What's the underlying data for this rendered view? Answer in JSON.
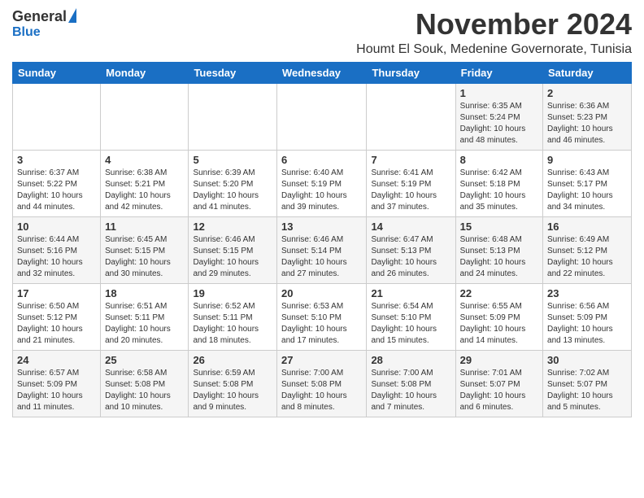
{
  "header": {
    "logo": {
      "general": "General",
      "blue": "Blue"
    },
    "title": "November 2024",
    "subtitle": "Houmt El Souk, Medenine Governorate, Tunisia"
  },
  "weekdays": [
    "Sunday",
    "Monday",
    "Tuesday",
    "Wednesday",
    "Thursday",
    "Friday",
    "Saturday"
  ],
  "weeks": [
    [
      {
        "day": "",
        "info": ""
      },
      {
        "day": "",
        "info": ""
      },
      {
        "day": "",
        "info": ""
      },
      {
        "day": "",
        "info": ""
      },
      {
        "day": "",
        "info": ""
      },
      {
        "day": "1",
        "info": "Sunrise: 6:35 AM\nSunset: 5:24 PM\nDaylight: 10 hours\nand 48 minutes."
      },
      {
        "day": "2",
        "info": "Sunrise: 6:36 AM\nSunset: 5:23 PM\nDaylight: 10 hours\nand 46 minutes."
      }
    ],
    [
      {
        "day": "3",
        "info": "Sunrise: 6:37 AM\nSunset: 5:22 PM\nDaylight: 10 hours\nand 44 minutes."
      },
      {
        "day": "4",
        "info": "Sunrise: 6:38 AM\nSunset: 5:21 PM\nDaylight: 10 hours\nand 42 minutes."
      },
      {
        "day": "5",
        "info": "Sunrise: 6:39 AM\nSunset: 5:20 PM\nDaylight: 10 hours\nand 41 minutes."
      },
      {
        "day": "6",
        "info": "Sunrise: 6:40 AM\nSunset: 5:19 PM\nDaylight: 10 hours\nand 39 minutes."
      },
      {
        "day": "7",
        "info": "Sunrise: 6:41 AM\nSunset: 5:19 PM\nDaylight: 10 hours\nand 37 minutes."
      },
      {
        "day": "8",
        "info": "Sunrise: 6:42 AM\nSunset: 5:18 PM\nDaylight: 10 hours\nand 35 minutes."
      },
      {
        "day": "9",
        "info": "Sunrise: 6:43 AM\nSunset: 5:17 PM\nDaylight: 10 hours\nand 34 minutes."
      }
    ],
    [
      {
        "day": "10",
        "info": "Sunrise: 6:44 AM\nSunset: 5:16 PM\nDaylight: 10 hours\nand 32 minutes."
      },
      {
        "day": "11",
        "info": "Sunrise: 6:45 AM\nSunset: 5:15 PM\nDaylight: 10 hours\nand 30 minutes."
      },
      {
        "day": "12",
        "info": "Sunrise: 6:46 AM\nSunset: 5:15 PM\nDaylight: 10 hours\nand 29 minutes."
      },
      {
        "day": "13",
        "info": "Sunrise: 6:46 AM\nSunset: 5:14 PM\nDaylight: 10 hours\nand 27 minutes."
      },
      {
        "day": "14",
        "info": "Sunrise: 6:47 AM\nSunset: 5:13 PM\nDaylight: 10 hours\nand 26 minutes."
      },
      {
        "day": "15",
        "info": "Sunrise: 6:48 AM\nSunset: 5:13 PM\nDaylight: 10 hours\nand 24 minutes."
      },
      {
        "day": "16",
        "info": "Sunrise: 6:49 AM\nSunset: 5:12 PM\nDaylight: 10 hours\nand 22 minutes."
      }
    ],
    [
      {
        "day": "17",
        "info": "Sunrise: 6:50 AM\nSunset: 5:12 PM\nDaylight: 10 hours\nand 21 minutes."
      },
      {
        "day": "18",
        "info": "Sunrise: 6:51 AM\nSunset: 5:11 PM\nDaylight: 10 hours\nand 20 minutes."
      },
      {
        "day": "19",
        "info": "Sunrise: 6:52 AM\nSunset: 5:11 PM\nDaylight: 10 hours\nand 18 minutes."
      },
      {
        "day": "20",
        "info": "Sunrise: 6:53 AM\nSunset: 5:10 PM\nDaylight: 10 hours\nand 17 minutes."
      },
      {
        "day": "21",
        "info": "Sunrise: 6:54 AM\nSunset: 5:10 PM\nDaylight: 10 hours\nand 15 minutes."
      },
      {
        "day": "22",
        "info": "Sunrise: 6:55 AM\nSunset: 5:09 PM\nDaylight: 10 hours\nand 14 minutes."
      },
      {
        "day": "23",
        "info": "Sunrise: 6:56 AM\nSunset: 5:09 PM\nDaylight: 10 hours\nand 13 minutes."
      }
    ],
    [
      {
        "day": "24",
        "info": "Sunrise: 6:57 AM\nSunset: 5:09 PM\nDaylight: 10 hours\nand 11 minutes."
      },
      {
        "day": "25",
        "info": "Sunrise: 6:58 AM\nSunset: 5:08 PM\nDaylight: 10 hours\nand 10 minutes."
      },
      {
        "day": "26",
        "info": "Sunrise: 6:59 AM\nSunset: 5:08 PM\nDaylight: 10 hours\nand 9 minutes."
      },
      {
        "day": "27",
        "info": "Sunrise: 7:00 AM\nSunset: 5:08 PM\nDaylight: 10 hours\nand 8 minutes."
      },
      {
        "day": "28",
        "info": "Sunrise: 7:00 AM\nSunset: 5:08 PM\nDaylight: 10 hours\nand 7 minutes."
      },
      {
        "day": "29",
        "info": "Sunrise: 7:01 AM\nSunset: 5:07 PM\nDaylight: 10 hours\nand 6 minutes."
      },
      {
        "day": "30",
        "info": "Sunrise: 7:02 AM\nSunset: 5:07 PM\nDaylight: 10 hours\nand 5 minutes."
      }
    ]
  ]
}
